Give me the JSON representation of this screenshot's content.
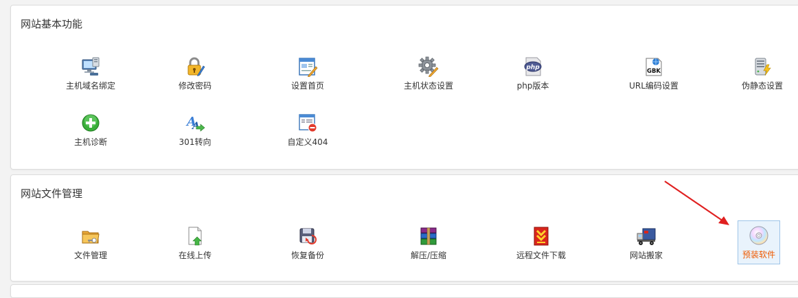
{
  "sections": [
    {
      "title": "网站基本功能",
      "items": [
        {
          "label": "主机域名绑定",
          "icon": "monitor-network-icon"
        },
        {
          "label": "修改密码",
          "icon": "lock-pencil-icon"
        },
        {
          "label": "设置首页",
          "icon": "page-edit-icon"
        },
        {
          "label": "主机状态设置",
          "icon": "gear-pencil-icon"
        },
        {
          "label": "php版本",
          "icon": "php-icon"
        },
        {
          "label": "URL编码设置",
          "icon": "gbk-encoding-icon"
        },
        {
          "label": "伪静态设置",
          "icon": "server-lightning-icon"
        },
        {
          "label": "主机诊断",
          "icon": "green-plus-icon"
        },
        {
          "label": "301转向",
          "icon": "font-arrow-icon"
        },
        {
          "label": "自定义404",
          "icon": "window-error-icon"
        }
      ]
    },
    {
      "title": "网站文件管理",
      "items": [
        {
          "label": "文件管理",
          "icon": "folder-key-icon"
        },
        {
          "label": "在线上传",
          "icon": "file-upload-icon"
        },
        {
          "label": "恢复备份",
          "icon": "backup-restore-icon"
        },
        {
          "label": "解压/压缩",
          "icon": "archive-books-icon"
        },
        {
          "label": "远程文件下载",
          "icon": "remote-download-icon"
        },
        {
          "label": "网站搬家",
          "icon": "moving-truck-icon"
        },
        {
          "label": "预装软件",
          "icon": "cd-disc-icon",
          "selected": true
        }
      ]
    }
  ],
  "colors": {
    "selected_label": "#ef5a00",
    "selected_border": "#9ec4e8",
    "selected_bg": "#e9f3fc",
    "annotation_arrow": "#e02020"
  }
}
